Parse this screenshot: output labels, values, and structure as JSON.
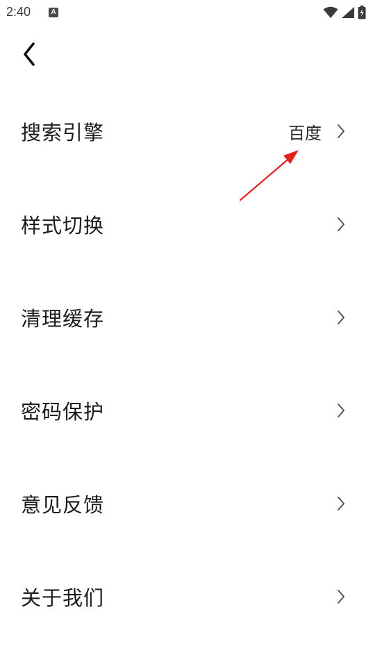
{
  "status_bar": {
    "time": "2:40",
    "notification_icon_letter": "A",
    "icons": [
      "wifi-icon",
      "cellular-signal-icon",
      "battery-charging-icon"
    ]
  },
  "header": {
    "back_icon": "chevron-left-icon"
  },
  "settings": {
    "items": [
      {
        "label": "搜索引擎",
        "value": "百度"
      },
      {
        "label": "样式切换",
        "value": ""
      },
      {
        "label": "清理缓存",
        "value": ""
      },
      {
        "label": "密码保护",
        "value": ""
      },
      {
        "label": "意见反馈",
        "value": ""
      },
      {
        "label": "关于我们",
        "value": ""
      }
    ]
  },
  "colors": {
    "background": "#ffffff",
    "text": "#1c1c1c",
    "chevron": "#555555",
    "annotation_arrow": "#e0201b"
  }
}
